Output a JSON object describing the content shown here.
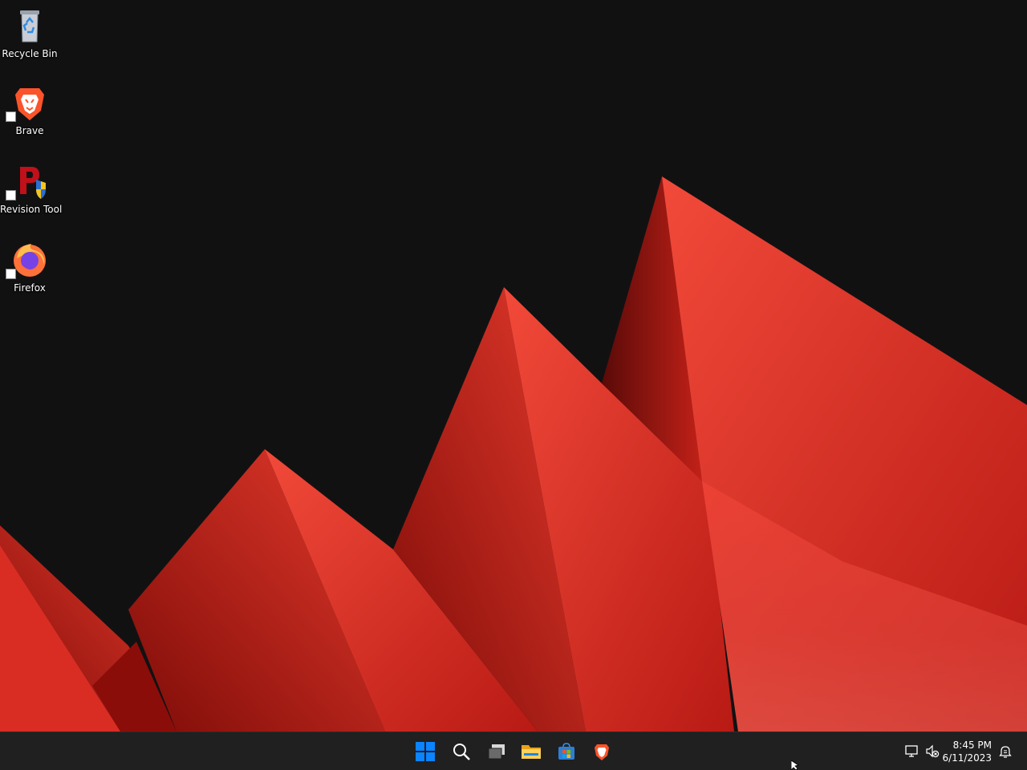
{
  "desktop": {
    "icons": [
      {
        "label": "Recycle Bin",
        "icon": "recycle-bin-icon"
      },
      {
        "label": "Brave",
        "icon": "brave-icon",
        "shortcut": true
      },
      {
        "label": "Revision Tool",
        "icon": "revision-tool-icon",
        "shortcut": true
      },
      {
        "label": "Firefox",
        "icon": "firefox-icon",
        "shortcut": true
      }
    ]
  },
  "taskbar": {
    "pinned": [
      "start-icon",
      "search-icon",
      "task-view-icon",
      "file-explorer-icon",
      "microsoft-store-icon",
      "brave-icon"
    ],
    "tray": [
      "network-icon",
      "volume-muted-icon",
      "notification-icon"
    ],
    "clock": {
      "time": "8:45 PM",
      "date": "6/11/2023"
    }
  },
  "colors": {
    "background": "#121112",
    "accent_red": "#e8352b",
    "taskbar": "#202020",
    "start_blue": "#0a84ff"
  }
}
